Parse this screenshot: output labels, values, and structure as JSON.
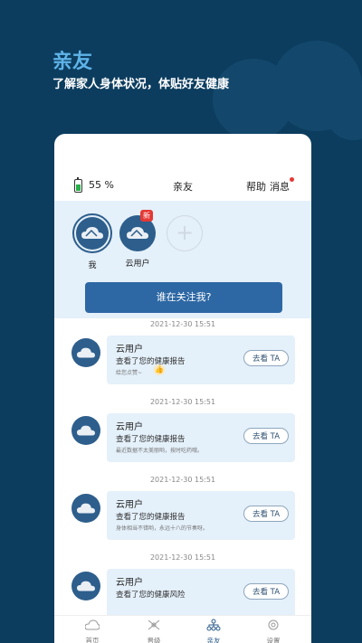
{
  "promo": {
    "title": "亲友",
    "subtitle": "了解家人身体状况，体贴好友健康"
  },
  "status": {
    "battery": "55 %",
    "page_title": "亲友",
    "help_label": "帮助",
    "messages_label": "消息"
  },
  "friends": {
    "me_label": "我",
    "friend_label": "云用户",
    "new_badge": "新",
    "add_symbol": "+"
  },
  "cta_label": "谁在关注我?",
  "feed": [
    {
      "timestamp": "2021-12-30 15:51",
      "name": "云用户",
      "desc": "查看了您的健康报告",
      "note": "给您点赞~",
      "button": "去看 TA"
    },
    {
      "timestamp": "2021-12-30 15:51",
      "name": "云用户",
      "desc": "查看了您的健康报告",
      "note": "最近数据不太美丽哟，按时吃药哦。",
      "button": "去看 TA"
    },
    {
      "timestamp": "2021-12-30 15:51",
      "name": "云用户",
      "desc": "查看了您的健康报告",
      "note": "身体相当不错哟，永远十八的节奏呀。",
      "button": "去看 TA"
    },
    {
      "timestamp": "2021-12-30 15:51",
      "name": "云用户",
      "desc": "查看了您的健康风险",
      "note": "",
      "button": "去看 TA"
    }
  ],
  "tabs": [
    {
      "label": "首页",
      "icon": "home-icon"
    },
    {
      "label": "晋级",
      "icon": "levels-icon"
    },
    {
      "label": "亲友",
      "icon": "friends-icon"
    },
    {
      "label": "设置",
      "icon": "settings-icon"
    }
  ],
  "colors": {
    "accent": "#2d68a4",
    "background": "#0c3d5f",
    "card": "#e4f0fa",
    "badge": "#e53935"
  }
}
